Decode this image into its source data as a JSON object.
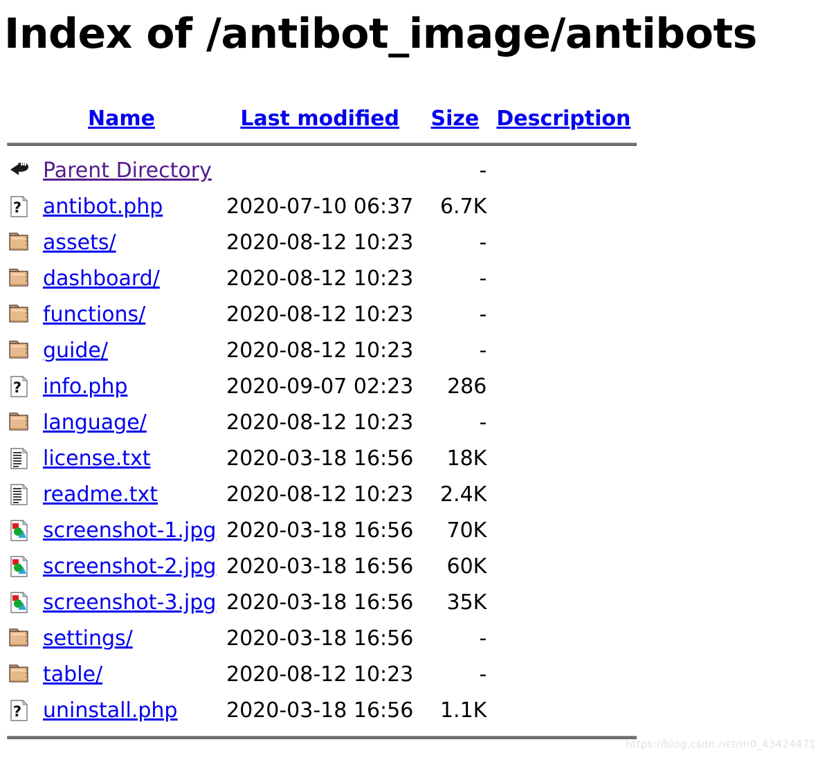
{
  "page": {
    "title": "Index of /antibot_image/antibots"
  },
  "table": {
    "headers": [
      {
        "label": "Name",
        "name": "column-header-name"
      },
      {
        "label": "Last modified",
        "name": "column-header-last-modified"
      },
      {
        "label": "Size",
        "name": "column-header-size"
      },
      {
        "label": "Description",
        "name": "column-header-description"
      }
    ],
    "rows": [
      {
        "icon": "back-icon",
        "name": "Parent Directory",
        "modified": "",
        "size": "-",
        "description": "",
        "link_state": "visited"
      },
      {
        "icon": "unknown-file-icon",
        "name": "antibot.php",
        "modified": "2020-07-10 06:37",
        "size": "6.7K",
        "description": "",
        "link_state": "normal"
      },
      {
        "icon": "folder-icon",
        "name": "assets/",
        "modified": "2020-08-12 10:23",
        "size": "-",
        "description": "",
        "link_state": "normal"
      },
      {
        "icon": "folder-icon",
        "name": "dashboard/",
        "modified": "2020-08-12 10:23",
        "size": "-",
        "description": "",
        "link_state": "normal"
      },
      {
        "icon": "folder-icon",
        "name": "functions/",
        "modified": "2020-08-12 10:23",
        "size": "-",
        "description": "",
        "link_state": "normal"
      },
      {
        "icon": "folder-icon",
        "name": "guide/",
        "modified": "2020-08-12 10:23",
        "size": "-",
        "description": "",
        "link_state": "normal"
      },
      {
        "icon": "unknown-file-icon",
        "name": "info.php",
        "modified": "2020-09-07 02:23",
        "size": "286",
        "description": "",
        "link_state": "normal"
      },
      {
        "icon": "folder-icon",
        "name": "language/",
        "modified": "2020-08-12 10:23",
        "size": "-",
        "description": "",
        "link_state": "normal"
      },
      {
        "icon": "text-file-icon",
        "name": "license.txt",
        "modified": "2020-03-18 16:56",
        "size": "18K",
        "description": "",
        "link_state": "normal"
      },
      {
        "icon": "text-file-icon",
        "name": "readme.txt",
        "modified": "2020-08-12 10:23",
        "size": "2.4K",
        "description": "",
        "link_state": "normal"
      },
      {
        "icon": "image-file-icon",
        "name": "screenshot-1.jpg",
        "modified": "2020-03-18 16:56",
        "size": "70K",
        "description": "",
        "link_state": "normal"
      },
      {
        "icon": "image-file-icon",
        "name": "screenshot-2.jpg",
        "modified": "2020-03-18 16:56",
        "size": "60K",
        "description": "",
        "link_state": "normal"
      },
      {
        "icon": "image-file-icon",
        "name": "screenshot-3.jpg",
        "modified": "2020-03-18 16:56",
        "size": "35K",
        "description": "",
        "link_state": "normal"
      },
      {
        "icon": "folder-icon",
        "name": "settings/",
        "modified": "2020-03-18 16:56",
        "size": "-",
        "description": "",
        "link_state": "normal"
      },
      {
        "icon": "folder-icon",
        "name": "table/",
        "modified": "2020-08-12 10:23",
        "size": "-",
        "description": "",
        "link_state": "normal"
      },
      {
        "icon": "unknown-file-icon",
        "name": "uninstall.php",
        "modified": "2020-03-18 16:56",
        "size": "1.1K",
        "description": "",
        "link_state": "normal"
      }
    ]
  },
  "watermark": {
    "text": "https://blog.csdn.net/m0_43424471"
  },
  "colors": {
    "link": "#0000EE",
    "visited_link": "#551A8B",
    "rule": "#6e6e6e",
    "folder_icon": "#E8B98A",
    "text": "#000000",
    "watermark": "#e2e2e2"
  }
}
